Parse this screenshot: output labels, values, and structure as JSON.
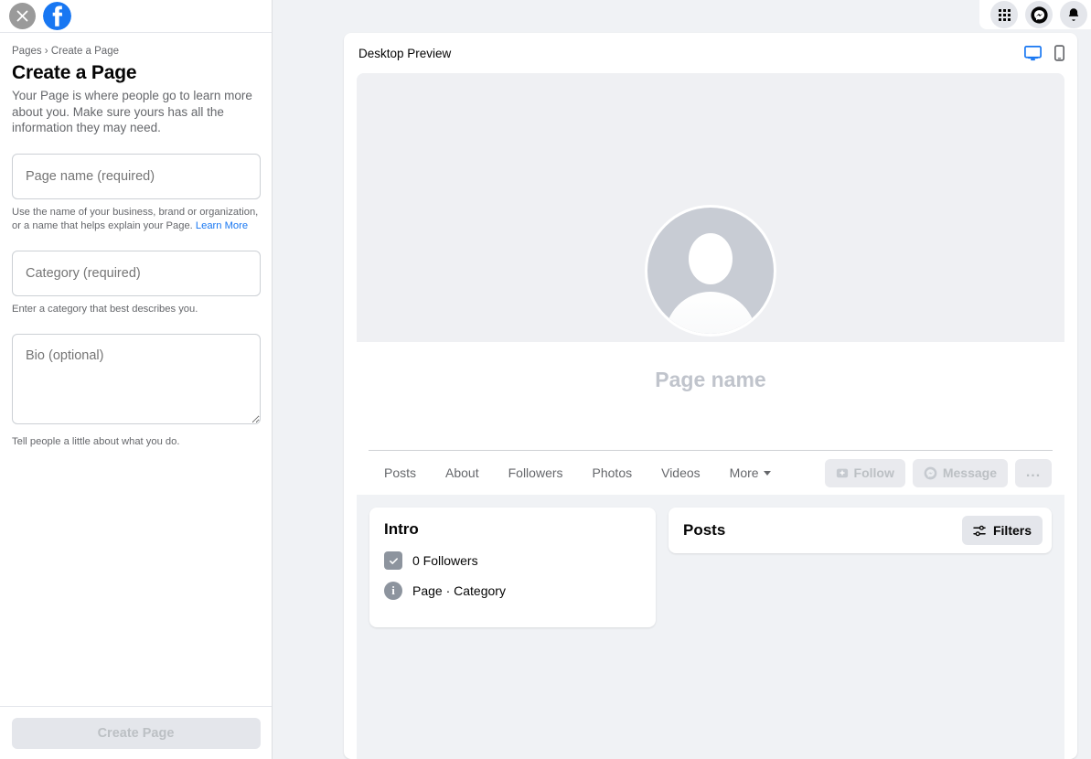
{
  "sidebar": {
    "close_icon": "close-icon",
    "brand_icon": "facebook-logo",
    "breadcrumb": "Pages › Create a Page",
    "title": "Create a Page",
    "description": "Your Page is where people go to learn more about you. Make sure yours has all the information they may need.",
    "fields": {
      "page_name_placeholder": "Page name (required)",
      "page_name_value": "",
      "page_name_helper": "Use the name of your business, brand or organization, or a name that helps explain your Page.",
      "page_name_helper_link": "Learn More",
      "category_placeholder": "Category (required)",
      "category_value": "",
      "category_helper": "Enter a category that best describes you.",
      "bio_placeholder": "Bio (optional)",
      "bio_value": "",
      "bio_helper": "Tell people a little about what you do."
    },
    "submit_label": "Create Page"
  },
  "topbar": {
    "menu_icon": "grid-menu-icon",
    "messenger_icon": "messenger-icon",
    "notifications_icon": "notifications-icon"
  },
  "preview": {
    "title": "Desktop Preview",
    "desktop_icon": "desktop-monitor-icon",
    "mobile_icon": "mobile-phone-icon",
    "active_view": "desktop"
  },
  "page_mock": {
    "page_name": "Page name",
    "avatar_icon": "default-avatar-icon",
    "tabs": [
      {
        "label": "Posts"
      },
      {
        "label": "About"
      },
      {
        "label": "Followers"
      },
      {
        "label": "Photos"
      },
      {
        "label": "Videos"
      },
      {
        "label": "More"
      }
    ],
    "actions": [
      {
        "label": "Follow",
        "icon": "follow-person-add-icon"
      },
      {
        "label": "Message",
        "icon": "messenger-icon"
      },
      {
        "label": "...",
        "icon": "more-options-icon"
      }
    ],
    "intro": {
      "title": "Intro",
      "rows": [
        {
          "label": "0 Followers",
          "icon": "followers-badge-icon"
        },
        {
          "label": "Page · Category",
          "icon": "info-icon"
        }
      ]
    },
    "posts": {
      "title": "Posts",
      "filters_label": "Filters",
      "filters_icon": "sliders-filter-icon"
    }
  },
  "colors": {
    "brand_blue": "#1877f2",
    "page_bg": "#f0f2f5",
    "card_bg": "#ffffff",
    "disabled_text": "#bcc0c4",
    "secondary_text": "#65676b"
  }
}
